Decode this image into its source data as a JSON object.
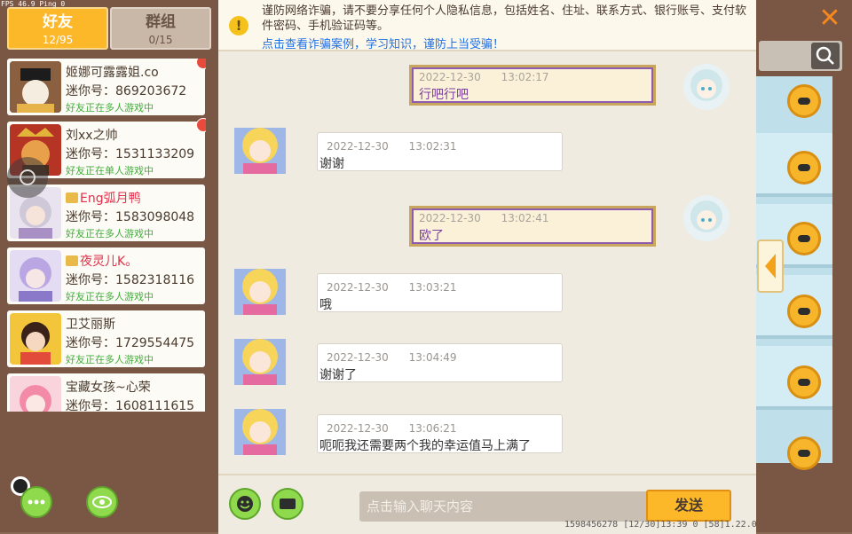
{
  "fps": "FPS 46.9  Ping 0",
  "tabs": [
    {
      "label": "好友",
      "count": "12/95"
    },
    {
      "label": "群组",
      "count": "0/15"
    }
  ],
  "friends": [
    {
      "name": "姬娜可露露姐.co",
      "id": "迷你号：869203672",
      "status": "好友正在多人游戏中",
      "unread": true
    },
    {
      "name": "刘xx之帅",
      "id": "迷你号：1531133209",
      "status": "好友正在单人游戏中",
      "unread": true
    },
    {
      "name": "Eng弧月鸭",
      "id": "迷你号：1583098048",
      "status": "好友正在多人游戏中",
      "vip": true,
      "red_name": true
    },
    {
      "name": "夜灵儿K。",
      "id": "迷你号：1582318116",
      "status": "好友正在多人游戏中",
      "vip": true,
      "red_name": true
    },
    {
      "name": "卫艾丽斯",
      "id": "迷你号：1729554475",
      "status": "好友正在多人游戏中"
    },
    {
      "name": "宝藏女孩~心荣",
      "id": "迷你号：1608111615",
      "status": ""
    }
  ],
  "notice": {
    "text": "谨防网络诈骗，请不要分享任何个人隐私信息，包括姓名、住址、联系方式、银行账号、支付软件密码、手机验证码等。",
    "link": "点击查看诈骗案例，学习知识，谨防上当受骗！",
    "icon": "warning-icon"
  },
  "messages": [
    {
      "side": "right",
      "time": "2022-12-30      13:02:17",
      "text": "行吧行吧"
    },
    {
      "side": "left",
      "time": "2022-12-30      13:02:31",
      "text": "谢谢"
    },
    {
      "side": "right",
      "time": "2022-12-30      13:02:41",
      "text": "欧了"
    },
    {
      "side": "left",
      "time": "2022-12-30      13:03:21",
      "text": "哦"
    },
    {
      "side": "left",
      "time": "2022-12-30      13:04:49",
      "text": "谢谢了"
    },
    {
      "side": "left",
      "time": "2022-12-30      13:06:21",
      "text": "呃呃我还需要两个我的幸运值马上满了"
    }
  ],
  "input": {
    "placeholder": "点击输入聊天内容",
    "send_label": "发送"
  },
  "footer": "1598456278   [12/30]13:39 0   [58]1.22.0",
  "close_label": "✕",
  "colors": {
    "accent": "#fdb82a",
    "link": "#1f6fe5",
    "online": "#3fae3a"
  }
}
